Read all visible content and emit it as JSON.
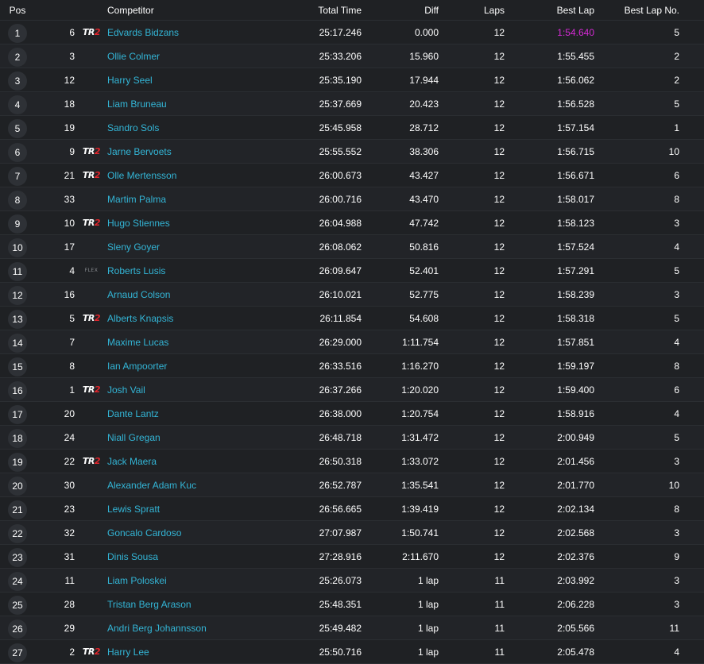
{
  "colors": {
    "background": "#1f2124",
    "row_alt": "#222428",
    "link": "#33b5d6",
    "fastest_lap": "#d62ad6",
    "badge": "#2e3136",
    "tr2_accent": "#e0242b"
  },
  "columns": {
    "pos": "Pos",
    "competitor": "Competitor",
    "total_time": "Total Time",
    "diff": "Diff",
    "laps": "Laps",
    "best_lap": "Best Lap",
    "best_lap_no": "Best Lap No."
  },
  "logo_text": {
    "tr2_main": "TR",
    "tr2_accent": "2",
    "flex": "FLEX"
  },
  "rows": [
    {
      "pos": "1",
      "num": "6",
      "logo": "tr2",
      "name": "Edvards Bidzans",
      "total": "25:17.246",
      "diff": "0.000",
      "laps": "12",
      "best": "1:54.640",
      "best_no": "5",
      "fastest": true
    },
    {
      "pos": "2",
      "num": "3",
      "logo": "",
      "name": "Ollie Colmer",
      "total": "25:33.206",
      "diff": "15.960",
      "laps": "12",
      "best": "1:55.455",
      "best_no": "2"
    },
    {
      "pos": "3",
      "num": "12",
      "logo": "",
      "name": "Harry Seel",
      "total": "25:35.190",
      "diff": "17.944",
      "laps": "12",
      "best": "1:56.062",
      "best_no": "2"
    },
    {
      "pos": "4",
      "num": "18",
      "logo": "",
      "name": "Liam Bruneau",
      "total": "25:37.669",
      "diff": "20.423",
      "laps": "12",
      "best": "1:56.528",
      "best_no": "5"
    },
    {
      "pos": "5",
      "num": "19",
      "logo": "",
      "name": "Sandro Sols",
      "total": "25:45.958",
      "diff": "28.712",
      "laps": "12",
      "best": "1:57.154",
      "best_no": "1"
    },
    {
      "pos": "6",
      "num": "9",
      "logo": "tr2",
      "name": "Jarne Bervoets",
      "total": "25:55.552",
      "diff": "38.306",
      "laps": "12",
      "best": "1:56.715",
      "best_no": "10"
    },
    {
      "pos": "7",
      "num": "21",
      "logo": "tr2",
      "name": "Olle Mertensson",
      "total": "26:00.673",
      "diff": "43.427",
      "laps": "12",
      "best": "1:56.671",
      "best_no": "6"
    },
    {
      "pos": "8",
      "num": "33",
      "logo": "",
      "name": "Martim Palma",
      "total": "26:00.716",
      "diff": "43.470",
      "laps": "12",
      "best": "1:58.017",
      "best_no": "8"
    },
    {
      "pos": "9",
      "num": "10",
      "logo": "tr2",
      "name": "Hugo Stiennes",
      "total": "26:04.988",
      "diff": "47.742",
      "laps": "12",
      "best": "1:58.123",
      "best_no": "3"
    },
    {
      "pos": "10",
      "num": "17",
      "logo": "",
      "name": "Sleny Goyer",
      "total": "26:08.062",
      "diff": "50.816",
      "laps": "12",
      "best": "1:57.524",
      "best_no": "4"
    },
    {
      "pos": "11",
      "num": "4",
      "logo": "flex",
      "name": "Roberts Lusis",
      "total": "26:09.647",
      "diff": "52.401",
      "laps": "12",
      "best": "1:57.291",
      "best_no": "5"
    },
    {
      "pos": "12",
      "num": "16",
      "logo": "",
      "name": "Arnaud Colson",
      "total": "26:10.021",
      "diff": "52.775",
      "laps": "12",
      "best": "1:58.239",
      "best_no": "3"
    },
    {
      "pos": "13",
      "num": "5",
      "logo": "tr2",
      "name": "Alberts Knapsis",
      "total": "26:11.854",
      "diff": "54.608",
      "laps": "12",
      "best": "1:58.318",
      "best_no": "5"
    },
    {
      "pos": "14",
      "num": "7",
      "logo": "",
      "name": "Maxime Lucas",
      "total": "26:29.000",
      "diff": "1:11.754",
      "laps": "12",
      "best": "1:57.851",
      "best_no": "4"
    },
    {
      "pos": "15",
      "num": "8",
      "logo": "",
      "name": "Ian Ampoorter",
      "total": "26:33.516",
      "diff": "1:16.270",
      "laps": "12",
      "best": "1:59.197",
      "best_no": "8"
    },
    {
      "pos": "16",
      "num": "1",
      "logo": "tr2",
      "name": "Josh Vail",
      "total": "26:37.266",
      "diff": "1:20.020",
      "laps": "12",
      "best": "1:59.400",
      "best_no": "6"
    },
    {
      "pos": "17",
      "num": "20",
      "logo": "",
      "name": "Dante Lantz",
      "total": "26:38.000",
      "diff": "1:20.754",
      "laps": "12",
      "best": "1:58.916",
      "best_no": "4"
    },
    {
      "pos": "18",
      "num": "24",
      "logo": "",
      "name": "Niall Gregan",
      "total": "26:48.718",
      "diff": "1:31.472",
      "laps": "12",
      "best": "2:00.949",
      "best_no": "5"
    },
    {
      "pos": "19",
      "num": "22",
      "logo": "tr2",
      "name": "Jack Maera",
      "total": "26:50.318",
      "diff": "1:33.072",
      "laps": "12",
      "best": "2:01.456",
      "best_no": "3"
    },
    {
      "pos": "20",
      "num": "30",
      "logo": "",
      "name": "Alexander Adam Kuc",
      "total": "26:52.787",
      "diff": "1:35.541",
      "laps": "12",
      "best": "2:01.770",
      "best_no": "10"
    },
    {
      "pos": "21",
      "num": "23",
      "logo": "",
      "name": "Lewis Spratt",
      "total": "26:56.665",
      "diff": "1:39.419",
      "laps": "12",
      "best": "2:02.134",
      "best_no": "8"
    },
    {
      "pos": "22",
      "num": "32",
      "logo": "",
      "name": "Goncalo Cardoso",
      "total": "27:07.987",
      "diff": "1:50.741",
      "laps": "12",
      "best": "2:02.568",
      "best_no": "3"
    },
    {
      "pos": "23",
      "num": "31",
      "logo": "",
      "name": "Dinis Sousa",
      "total": "27:28.916",
      "diff": "2:11.670",
      "laps": "12",
      "best": "2:02.376",
      "best_no": "9"
    },
    {
      "pos": "24",
      "num": "11",
      "logo": "",
      "name": "Liam Poloskei",
      "total": "25:26.073",
      "diff": "1 lap",
      "laps": "11",
      "best": "2:03.992",
      "best_no": "3"
    },
    {
      "pos": "25",
      "num": "28",
      "logo": "",
      "name": "Tristan Berg Arason",
      "total": "25:48.351",
      "diff": "1 lap",
      "laps": "11",
      "best": "2:06.228",
      "best_no": "3"
    },
    {
      "pos": "26",
      "num": "29",
      "logo": "",
      "name": "Andri Berg Johannsson",
      "total": "25:49.482",
      "diff": "1 lap",
      "laps": "11",
      "best": "2:05.566",
      "best_no": "11"
    },
    {
      "pos": "27",
      "num": "2",
      "logo": "tr2",
      "name": "Harry Lee",
      "total": "25:50.716",
      "diff": "1 lap",
      "laps": "11",
      "best": "2:05.478",
      "best_no": "4"
    }
  ]
}
